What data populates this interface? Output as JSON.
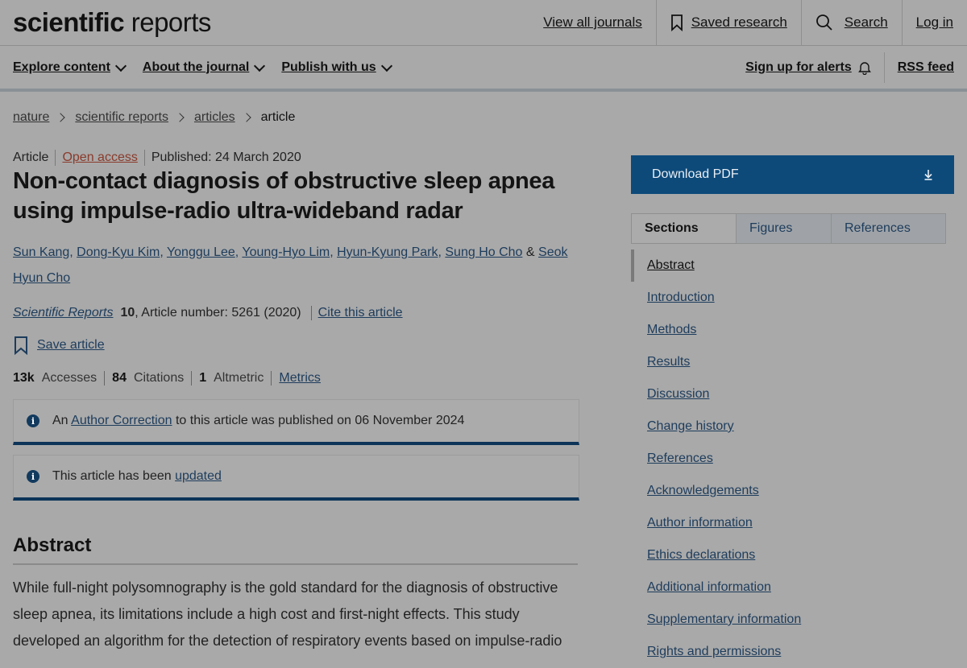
{
  "header": {
    "brand_bold": "scientific",
    "brand_light": " reports",
    "view_all": "View all journals",
    "saved": "Saved research",
    "search": "Search",
    "login": "Log in"
  },
  "subnav": {
    "explore": "Explore content",
    "about": "About the journal",
    "publish": "Publish with us",
    "alerts": "Sign up for alerts",
    "rss": "RSS feed"
  },
  "breadcrumb": [
    "nature",
    "scientific reports",
    "articles",
    "article"
  ],
  "article": {
    "type": "Article",
    "access": "Open access",
    "published": "Published: 24 March 2020",
    "title": "Non-contact diagnosis of obstructive sleep apnea using impulse-radio ultra-wideband radar",
    "authors": [
      "Sun Kang",
      "Dong-Kyu Kim",
      "Yonggu Lee",
      "Young-Hyo Lim",
      "Hyun-Kyung Park",
      "Sung Ho Cho"
    ],
    "last_author": "Seok Hyun Cho",
    "journal_name": "Scientific Reports",
    "volume": "10",
    "article_number": ", Article number: 5261 (2020)",
    "cite": "Cite this article",
    "save": "Save article",
    "accesses_value": "13k",
    "accesses_label": "Accesses",
    "citations_value": "84",
    "citations_label": "Citations",
    "altmetric_value": "1",
    "altmetric_label": "Altmetric",
    "metrics_link": "Metrics"
  },
  "notices": {
    "n1_pre": "An ",
    "n1_link": "Author Correction",
    "n1_post": " to this article was published on 06 November 2024",
    "n2_pre": "This article has been ",
    "n2_link": "updated"
  },
  "abstract": {
    "heading": "Abstract",
    "text": "While full-night polysomnography is the gold standard for the diagnosis of obstructive sleep apnea, its limitations include a high cost and first-night effects. This study developed an algorithm for the detection of respiratory events based on impulse-radio"
  },
  "sidebar": {
    "download": "Download PDF",
    "tabs": [
      "Sections",
      "Figures",
      "References"
    ],
    "sections": [
      "Abstract",
      "Introduction",
      "Methods",
      "Results",
      "Discussion",
      "Change history",
      "References",
      "Acknowledgements",
      "Author information",
      "Ethics declarations",
      "Additional information",
      "Supplementary information",
      "Rights and permissions"
    ]
  },
  "colors": {
    "accent": "#0d4a7a",
    "link": "#1d3c5c",
    "open_access": "#8a3b2b"
  }
}
